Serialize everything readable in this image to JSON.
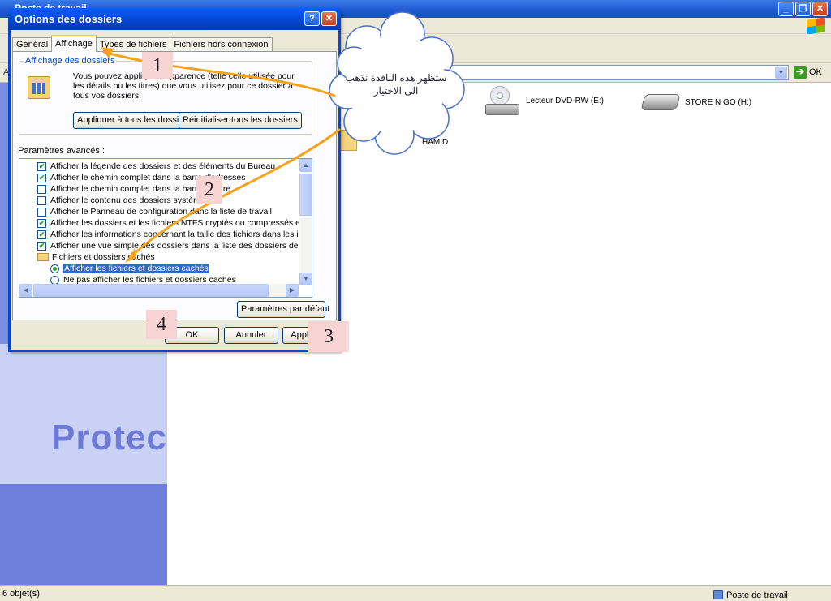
{
  "explorer": {
    "title": "Poste de travail",
    "address_label": "A",
    "go_label": "OK",
    "drives": [
      {
        "label": "Lecteur DVD-RW (E:)",
        "icon": "dvd-drive-icon"
      },
      {
        "label": "STORE N GO (H:)",
        "icon": "removable-drive-icon"
      },
      {
        "label": "HAMID",
        "icon": "folder-icon"
      }
    ],
    "left_pane_text": "Protec",
    "status_left": "6 objet(s)",
    "status_right": "Poste de travail"
  },
  "dialog": {
    "title": "Options des dossiers",
    "help_label": "?",
    "close_label": "✕",
    "tabs": [
      {
        "label": "Général",
        "active": false
      },
      {
        "label": "Affichage",
        "active": true
      },
      {
        "label": "Types de fichiers",
        "active": false
      },
      {
        "label": "Fichiers hors connexion",
        "active": false
      }
    ],
    "group_title": "Affichage des dossiers",
    "group_text": "Vous pouvez appliquer l'apparence (telle celle utilisée pour les détails ou les titres) que vous utilisez pour ce dossier à tous vos dossiers.",
    "apply_all_label": "Appliquer à tous les dossiers",
    "reset_all_label": "Réinitialiser tous les dossiers",
    "advanced_label": "Paramètres avancés :",
    "settings": [
      {
        "type": "checkbox",
        "checked": true,
        "label": "Afficher la légende des dossiers et des éléments du Bureau"
      },
      {
        "type": "checkbox",
        "checked": true,
        "label": "Afficher le chemin complet dans la barre d'adresses"
      },
      {
        "type": "checkbox",
        "checked": false,
        "label": "Afficher le chemin complet dans la barre de titre"
      },
      {
        "type": "checkbox",
        "checked": false,
        "label": "Afficher le contenu des dossiers système"
      },
      {
        "type": "checkbox",
        "checked": false,
        "label": "Afficher le Panneau de configuration dans la liste de travail"
      },
      {
        "type": "checkbox",
        "checked": true,
        "label": "Afficher les dossiers et les fichiers NTFS cryptés ou compressés en couleur"
      },
      {
        "type": "checkbox",
        "checked": true,
        "label": "Afficher les informations concernant la taille des fichiers dans les info-bulles"
      },
      {
        "type": "checkbox",
        "checked": true,
        "label": "Afficher une vue simple des dossiers dans la liste des dossiers de l'Explorateur"
      },
      {
        "type": "folder",
        "label": "Fichiers et dossiers cachés"
      },
      {
        "type": "radio",
        "checked": true,
        "selected": true,
        "label": "Afficher les fichiers et dossiers cachés"
      },
      {
        "type": "radio",
        "checked": false,
        "label": "Ne pas afficher les fichiers et dossiers cachés"
      }
    ],
    "defaults_label": "Paramètres par défaut",
    "ok_label": "OK",
    "cancel_label": "Annuler",
    "apply_label": "Appliquer"
  },
  "annotations": {
    "steps": [
      "1",
      "2",
      "3",
      "4"
    ],
    "cloud_text": "ستظهر هده النافدة نذهب الى الاختيار",
    "arrow_color": "#f7a21b"
  }
}
